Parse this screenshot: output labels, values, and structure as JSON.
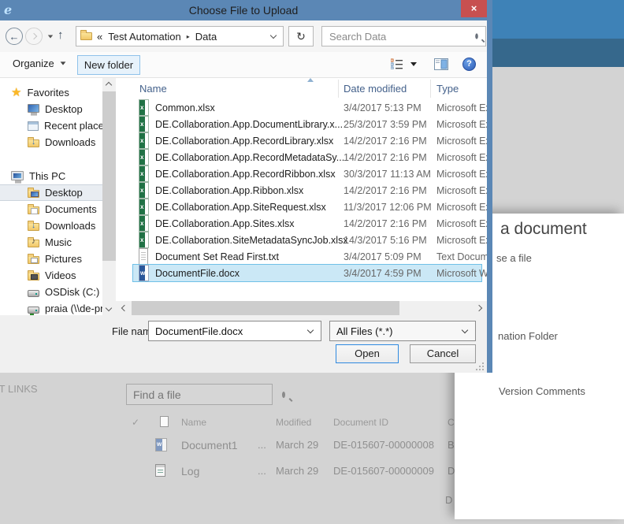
{
  "window": {
    "title": "Choose File to Upload",
    "close_glyph": "×",
    "ie_logo_glyph": "e"
  },
  "nav": {
    "back_glyph": "←",
    "up_glyph": "↑",
    "refresh_glyph": "↻",
    "breadcrumb_prefix": "«",
    "breadcrumb": [
      {
        "label": "Test Automation"
      },
      {
        "label": "Data"
      }
    ],
    "separator": "▸",
    "search_placeholder": "Search Data"
  },
  "toolbar": {
    "organize_label": "Organize",
    "new_folder_label": "New folder",
    "help_glyph": "?"
  },
  "sidebar": {
    "groups": [
      {
        "label": "Favorites",
        "icon": "star",
        "items": [
          {
            "label": "Desktop",
            "icon": "monitor"
          },
          {
            "label": "Recent places",
            "icon": "recent"
          },
          {
            "label": "Downloads",
            "icon": "folder-down"
          }
        ]
      },
      {
        "label": "This PC",
        "icon": "pc",
        "items": [
          {
            "label": "Desktop",
            "icon": "folder-desktop",
            "selected": true
          },
          {
            "label": "Documents",
            "icon": "folder-doc"
          },
          {
            "label": "Downloads",
            "icon": "folder-down"
          },
          {
            "label": "Music",
            "icon": "folder-music"
          },
          {
            "label": "Pictures",
            "icon": "folder-pic"
          },
          {
            "label": "Videos",
            "icon": "folder-vid"
          },
          {
            "label": "OSDisk (C:)",
            "icon": "drive"
          },
          {
            "label": "praia (\\\\de-prod.",
            "icon": "net-drive"
          }
        ]
      }
    ]
  },
  "filelist": {
    "columns": [
      "Name",
      "Date modified",
      "Type"
    ],
    "rows": [
      {
        "icon": "excel",
        "name": "Common.xlsx",
        "modified": "3/4/2017 5:13 PM",
        "type": "Microsoft Ex"
      },
      {
        "icon": "excel",
        "name": "DE.Collaboration.App.DocumentLibrary.x...",
        "modified": "25/3/2017 3:59 PM",
        "type": "Microsoft Ex"
      },
      {
        "icon": "excel",
        "name": "DE.Collaboration.App.RecordLibrary.xlsx",
        "modified": "14/2/2017 2:16 PM",
        "type": "Microsoft Ex"
      },
      {
        "icon": "excel",
        "name": "DE.Collaboration.App.RecordMetadataSy...",
        "modified": "14/2/2017 2:16 PM",
        "type": "Microsoft Ex"
      },
      {
        "icon": "excel",
        "name": "DE.Collaboration.App.RecordRibbon.xlsx",
        "modified": "30/3/2017 11:13 AM",
        "type": "Microsoft Ex"
      },
      {
        "icon": "excel",
        "name": "DE.Collaboration.App.Ribbon.xlsx",
        "modified": "14/2/2017 2:16 PM",
        "type": "Microsoft Ex"
      },
      {
        "icon": "excel",
        "name": "DE.Collaboration.App.SiteRequest.xlsx",
        "modified": "11/3/2017 12:06 PM",
        "type": "Microsoft Ex"
      },
      {
        "icon": "excel",
        "name": "DE.Collaboration.App.Sites.xlsx",
        "modified": "14/2/2017 2:16 PM",
        "type": "Microsoft Ex"
      },
      {
        "icon": "excel",
        "name": "DE.Collaboration.SiteMetadataSyncJob.xlsx",
        "modified": "14/3/2017 5:16 PM",
        "type": "Microsoft Ex"
      },
      {
        "icon": "txt",
        "name": "Document Set Read First.txt",
        "modified": "3/4/2017 5:09 PM",
        "type": "Text Docume"
      },
      {
        "icon": "word",
        "name": "DocumentFile.docx",
        "modified": "3/4/2017 4:59 PM",
        "type": "Microsoft W",
        "selected": true
      }
    ]
  },
  "footer": {
    "filename_label": "File name:",
    "filename_value": "DocumentFile.docx",
    "filetype_value": "All Files (*.*)",
    "open_label": "Open",
    "cancel_label": "Cancel"
  },
  "background": {
    "links_label": "EDIT LINKS",
    "find_placeholder": "Find a file",
    "table": {
      "check_glyph": "✓",
      "name_header": "Name",
      "modified_header": "Modified",
      "docid_header": "Document ID",
      "extra_header": "C",
      "rows": [
        {
          "icon": "wordbg",
          "name": "Document1",
          "ellipsis": "...",
          "modified": "March 29",
          "docid": "DE-015607-00000008",
          "extra": "B"
        },
        {
          "icon": "log",
          "name": "Log",
          "ellipsis": "...",
          "modified": "March 29",
          "docid": "DE-015607-00000009",
          "extra": "D"
        }
      ]
    },
    "partial_text": "D",
    "panel": {
      "heading": "a document",
      "choose_file_text": "se a file",
      "destination_text": "nation Folder",
      "version_comments_text": "Version Comments"
    }
  }
}
